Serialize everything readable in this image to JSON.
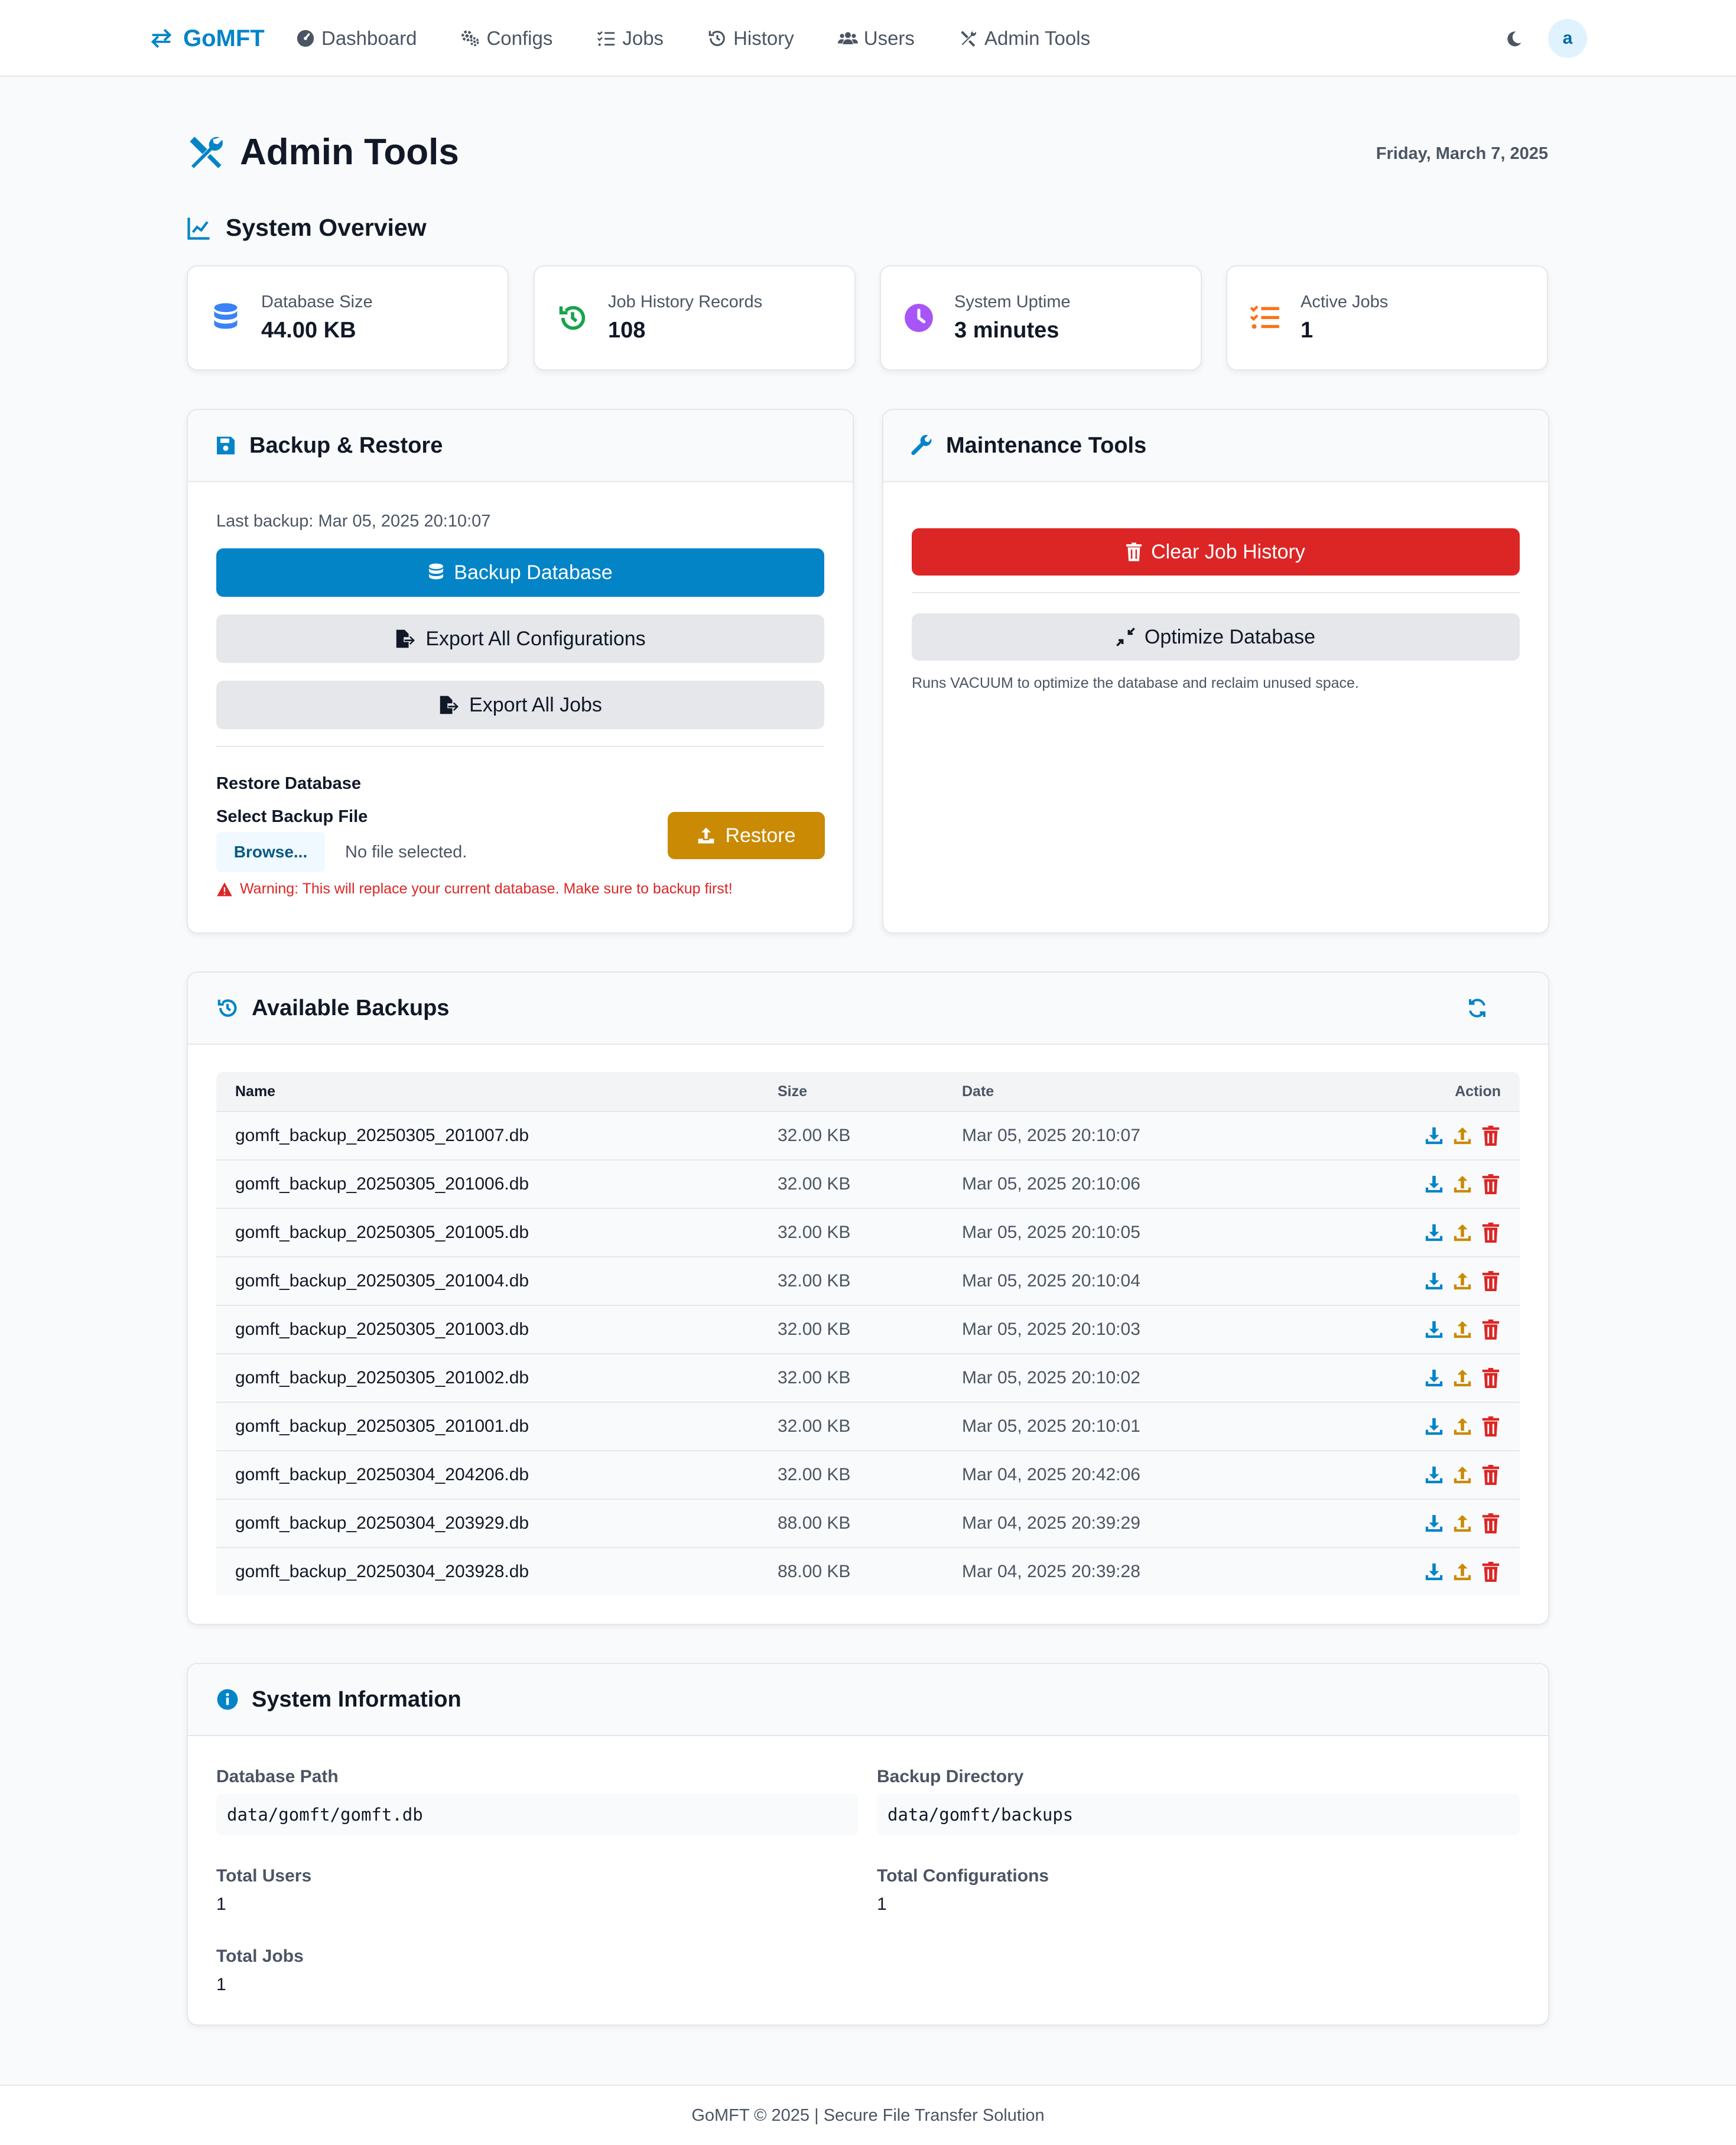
{
  "colors": {
    "primary": "#0284c7",
    "danger": "#dc2626",
    "warning": "#ca8a04",
    "success": "#16a34a",
    "purple": "#a855f7",
    "orange": "#f97316"
  },
  "navbar": {
    "brand": "GoMFT",
    "links": [
      {
        "label": "Dashboard",
        "icon": "gauge-icon"
      },
      {
        "label": "Configs",
        "icon": "gears-icon"
      },
      {
        "label": "Jobs",
        "icon": "list-check-icon"
      },
      {
        "label": "History",
        "icon": "history-icon"
      },
      {
        "label": "Users",
        "icon": "users-icon"
      },
      {
        "label": "Admin Tools",
        "icon": "tools-icon"
      }
    ],
    "avatar_letter": "a"
  },
  "header": {
    "title": "Admin Tools",
    "date": "Friday, March 7, 2025"
  },
  "overview": {
    "title": "System Overview",
    "stats": [
      {
        "label": "Database Size",
        "value": "44.00 KB"
      },
      {
        "label": "Job History Records",
        "value": "108"
      },
      {
        "label": "System Uptime",
        "value": "3 minutes"
      },
      {
        "label": "Active Jobs",
        "value": "1"
      }
    ]
  },
  "backup": {
    "title": "Backup & Restore",
    "last_backup": "Last backup: Mar 05, 2025 20:10:07",
    "backup_button": "Backup Database",
    "export_configs_button": "Export All Configurations",
    "export_jobs_button": "Export All Jobs",
    "restore_heading": "Restore Database",
    "select_label": "Select Backup File",
    "browse_button": "Browse...",
    "no_file": "No file selected.",
    "restore_button": "Restore",
    "warning": "Warning: This will replace your current database. Make sure to backup first!"
  },
  "maintenance": {
    "title": "Maintenance Tools",
    "clear_button": "Clear Job History",
    "optimize_button": "Optimize Database",
    "optimize_help": "Runs VACUUM to optimize the database and reclaim unused space."
  },
  "backups": {
    "title": "Available Backups",
    "columns": {
      "name": "Name",
      "size": "Size",
      "date": "Date",
      "action": "Action"
    },
    "rows": [
      {
        "name": "gomft_backup_20250305_201007.db",
        "size": "32.00 KB",
        "date": "Mar 05, 2025 20:10:07"
      },
      {
        "name": "gomft_backup_20250305_201006.db",
        "size": "32.00 KB",
        "date": "Mar 05, 2025 20:10:06"
      },
      {
        "name": "gomft_backup_20250305_201005.db",
        "size": "32.00 KB",
        "date": "Mar 05, 2025 20:10:05"
      },
      {
        "name": "gomft_backup_20250305_201004.db",
        "size": "32.00 KB",
        "date": "Mar 05, 2025 20:10:04"
      },
      {
        "name": "gomft_backup_20250305_201003.db",
        "size": "32.00 KB",
        "date": "Mar 05, 2025 20:10:03"
      },
      {
        "name": "gomft_backup_20250305_201002.db",
        "size": "32.00 KB",
        "date": "Mar 05, 2025 20:10:02"
      },
      {
        "name": "gomft_backup_20250305_201001.db",
        "size": "32.00 KB",
        "date": "Mar 05, 2025 20:10:01"
      },
      {
        "name": "gomft_backup_20250304_204206.db",
        "size": "32.00 KB",
        "date": "Mar 04, 2025 20:42:06"
      },
      {
        "name": "gomft_backup_20250304_203929.db",
        "size": "88.00 KB",
        "date": "Mar 04, 2025 20:39:29"
      },
      {
        "name": "gomft_backup_20250304_203928.db",
        "size": "88.00 KB",
        "date": "Mar 04, 2025 20:39:28"
      }
    ]
  },
  "sysinfo": {
    "title": "System Information",
    "db_path_label": "Database Path",
    "db_path": "data/gomft/gomft.db",
    "backup_dir_label": "Backup Directory",
    "backup_dir": "data/gomft/backups",
    "total_users_label": "Total Users",
    "total_users": "1",
    "total_configs_label": "Total Configurations",
    "total_configs": "1",
    "total_jobs_label": "Total Jobs",
    "total_jobs": "1"
  },
  "footer": {
    "text": "GoMFT © 2025 | Secure File Transfer Solution"
  }
}
